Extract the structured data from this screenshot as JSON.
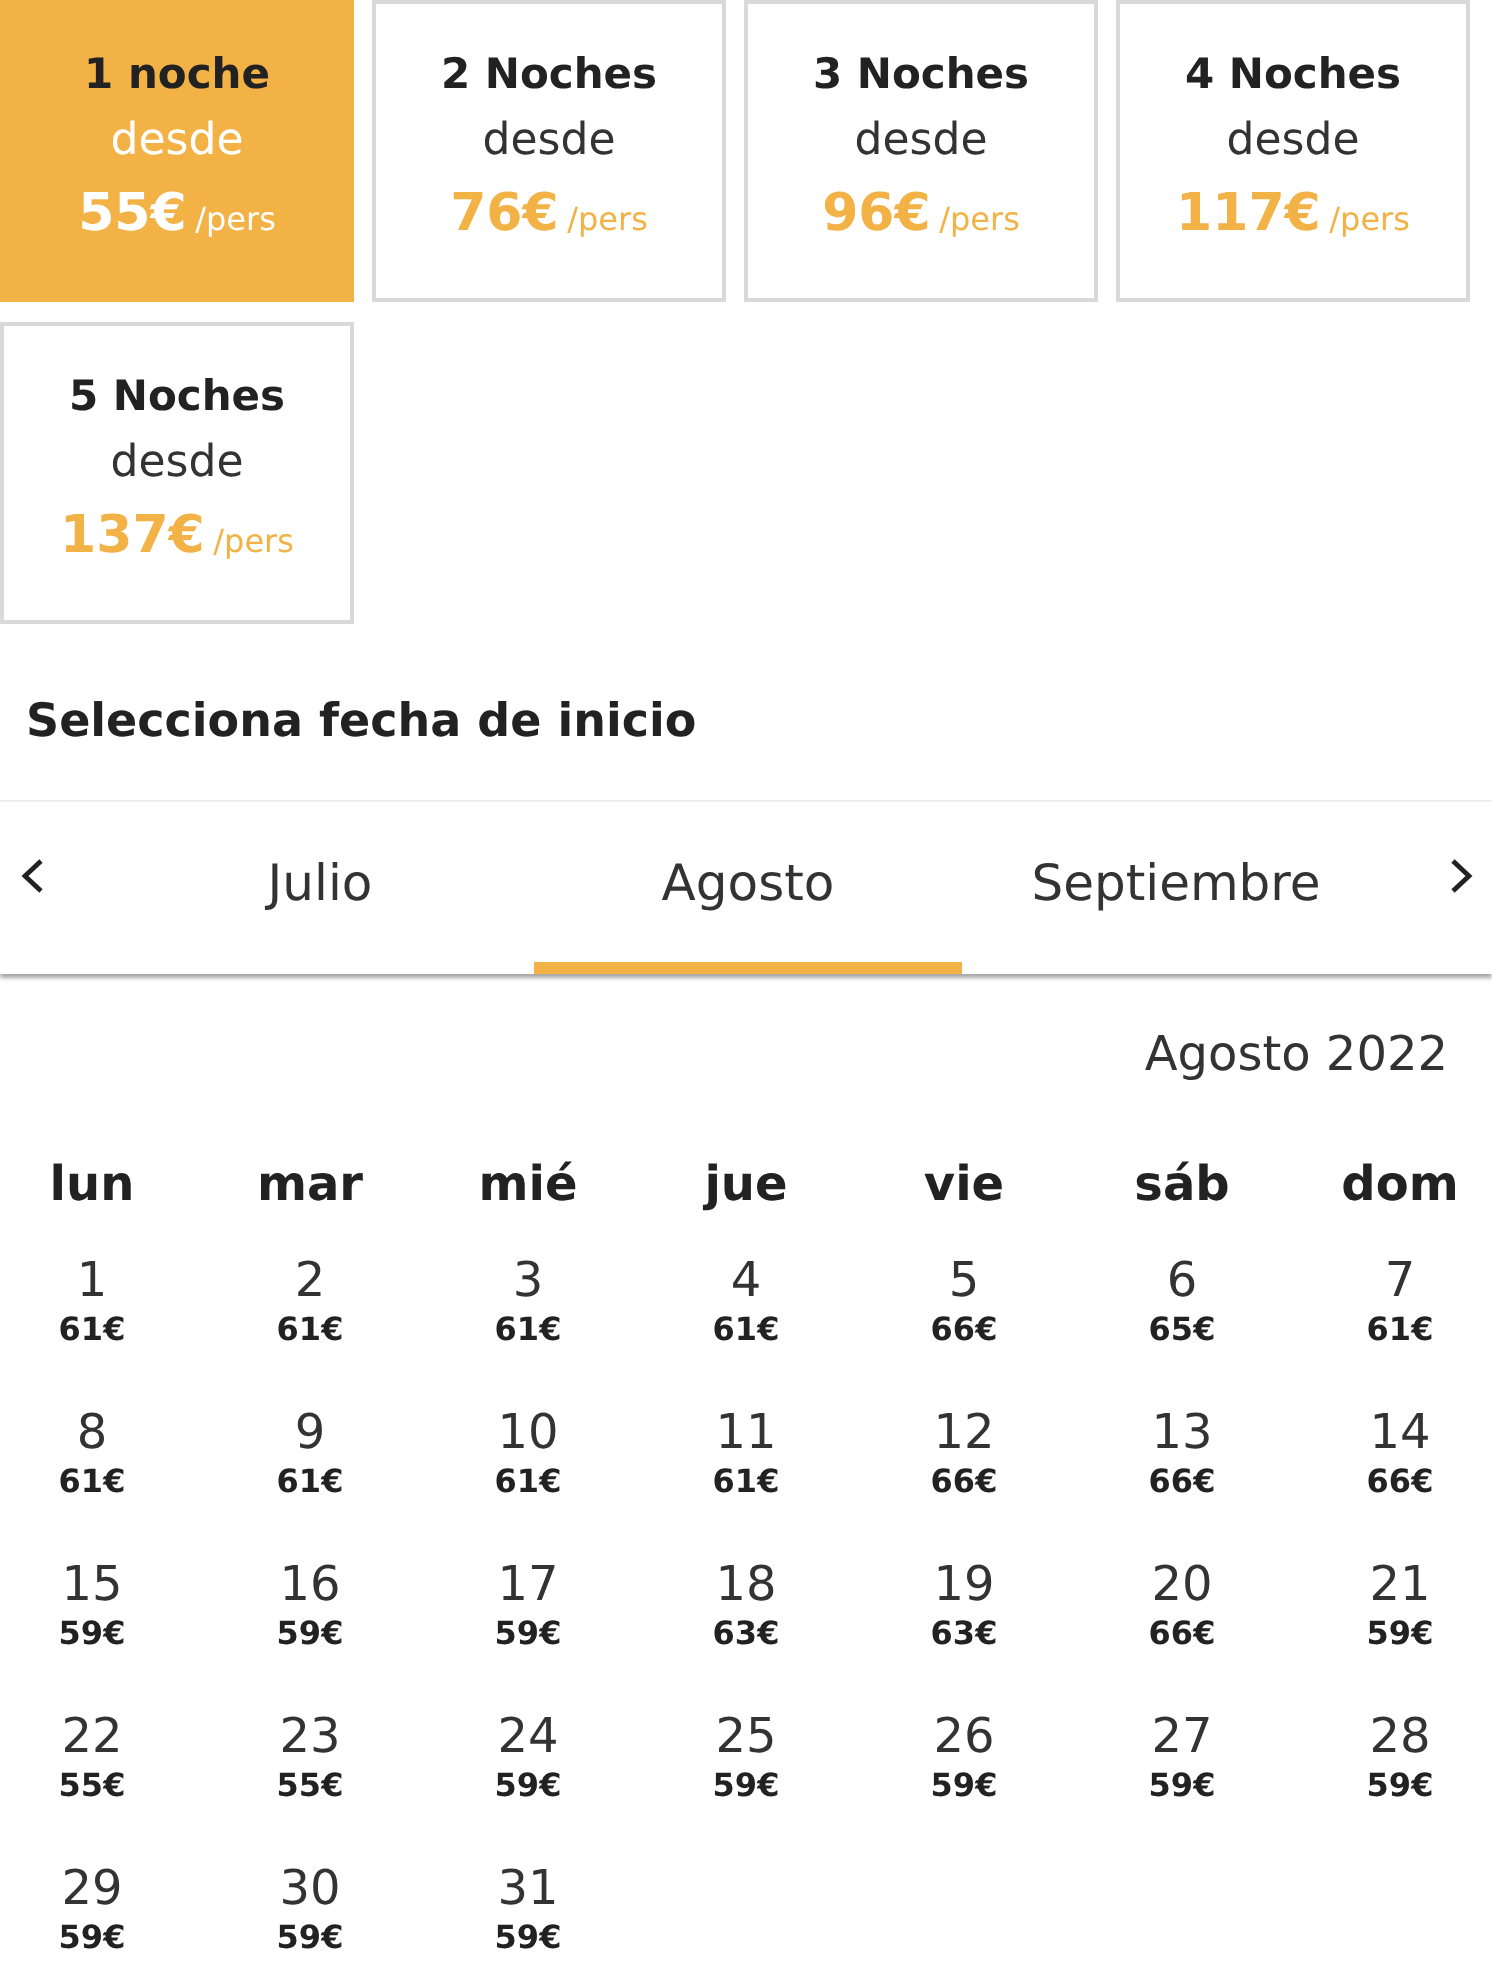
{
  "stay_options": [
    {
      "title": "1 noche",
      "label": "desde",
      "price": "55€",
      "unit": "/pers",
      "selected": true
    },
    {
      "title": "2 Noches",
      "label": "desde",
      "price": "76€",
      "unit": "/pers",
      "selected": false
    },
    {
      "title": "3 Noches",
      "label": "desde",
      "price": "96€",
      "unit": "/pers",
      "selected": false
    },
    {
      "title": "4 Noches",
      "label": "desde",
      "price": "117€",
      "unit": "/pers",
      "selected": false
    },
    {
      "title": "5 Noches",
      "label": "desde",
      "price": "137€",
      "unit": "/pers",
      "selected": false
    }
  ],
  "date_heading": "Selecciona fecha de inicio",
  "month_tabs": [
    {
      "label": "Julio",
      "selected": false
    },
    {
      "label": "Agosto",
      "selected": true
    },
    {
      "label": "Septiembre",
      "selected": false
    }
  ],
  "calendar": {
    "title": "Agosto 2022",
    "weekdays": [
      "lun",
      "mar",
      "mié",
      "jue",
      "vie",
      "sáb",
      "dom"
    ],
    "days": [
      {
        "day": "1",
        "price": "61€"
      },
      {
        "day": "2",
        "price": "61€"
      },
      {
        "day": "3",
        "price": "61€"
      },
      {
        "day": "4",
        "price": "61€"
      },
      {
        "day": "5",
        "price": "66€"
      },
      {
        "day": "6",
        "price": "65€"
      },
      {
        "day": "7",
        "price": "61€"
      },
      {
        "day": "8",
        "price": "61€"
      },
      {
        "day": "9",
        "price": "61€"
      },
      {
        "day": "10",
        "price": "61€"
      },
      {
        "day": "11",
        "price": "61€"
      },
      {
        "day": "12",
        "price": "66€"
      },
      {
        "day": "13",
        "price": "66€"
      },
      {
        "day": "14",
        "price": "66€"
      },
      {
        "day": "15",
        "price": "59€"
      },
      {
        "day": "16",
        "price": "59€"
      },
      {
        "day": "17",
        "price": "59€"
      },
      {
        "day": "18",
        "price": "63€"
      },
      {
        "day": "19",
        "price": "63€"
      },
      {
        "day": "20",
        "price": "66€"
      },
      {
        "day": "21",
        "price": "59€"
      },
      {
        "day": "22",
        "price": "55€"
      },
      {
        "day": "23",
        "price": "55€"
      },
      {
        "day": "24",
        "price": "59€"
      },
      {
        "day": "25",
        "price": "59€"
      },
      {
        "day": "26",
        "price": "59€"
      },
      {
        "day": "27",
        "price": "59€"
      },
      {
        "day": "28",
        "price": "59€"
      },
      {
        "day": "29",
        "price": "59€"
      },
      {
        "day": "30",
        "price": "59€"
      },
      {
        "day": "31",
        "price": "59€"
      }
    ]
  }
}
